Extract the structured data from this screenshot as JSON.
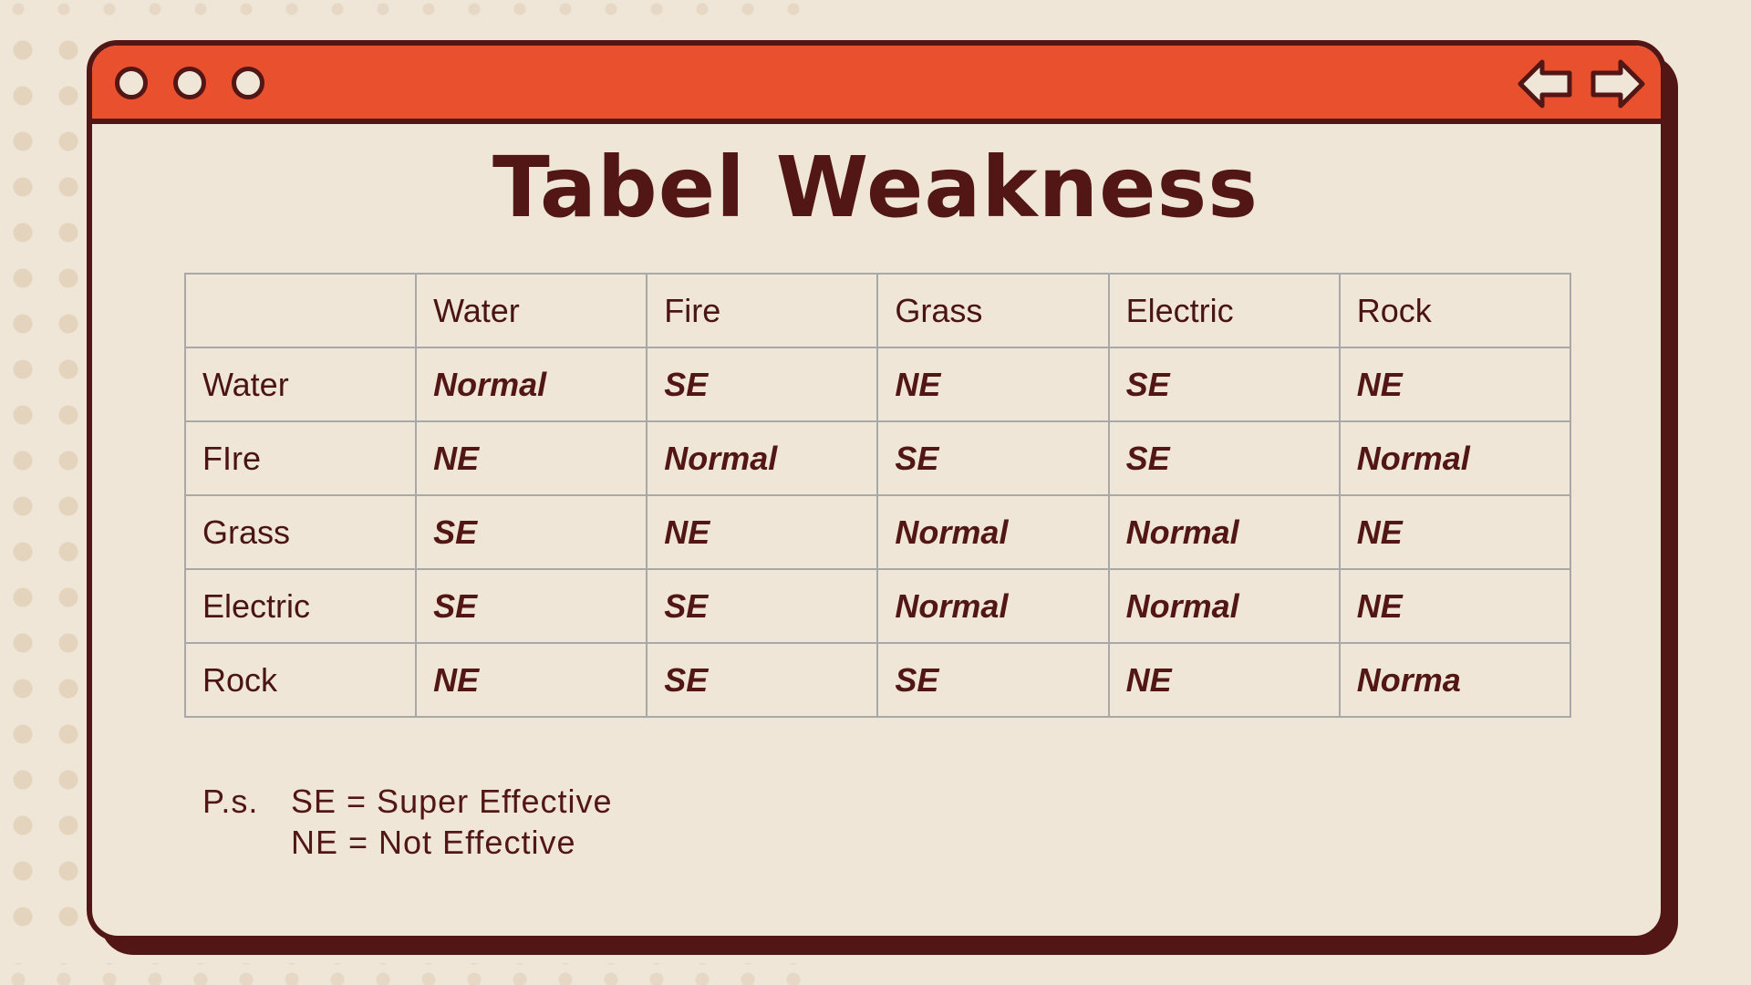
{
  "title": "Tabel Weakness",
  "colors": {
    "accent": "#e9502e",
    "dark": "#521614",
    "background": "#efe6d8"
  },
  "window": {
    "controls": [
      "circle-icon",
      "circle-icon",
      "circle-icon"
    ],
    "nav": [
      "arrow-left-icon",
      "arrow-right-icon"
    ]
  },
  "table": {
    "columns": [
      "",
      "Water",
      "Fire",
      "Grass",
      "Electric",
      "Rock"
    ],
    "rows": [
      {
        "label": "Water",
        "values": [
          "Normal",
          "SE",
          "NE",
          "SE",
          "NE"
        ]
      },
      {
        "label": "FIre",
        "values": [
          "NE",
          "Normal",
          "SE",
          "SE",
          "Normal"
        ]
      },
      {
        "label": "Grass",
        "values": [
          "SE",
          "NE",
          "Normal",
          "Normal",
          "NE"
        ]
      },
      {
        "label": "Electric",
        "values": [
          "SE",
          "SE",
          "Normal",
          "Normal",
          "NE"
        ]
      },
      {
        "label": "Rock",
        "values": [
          "NE",
          "SE",
          "SE",
          "NE",
          "Norma"
        ]
      }
    ]
  },
  "note": {
    "label": "P.s.",
    "line1": "SE = Super Effective",
    "line2": "NE = Not Effective"
  }
}
